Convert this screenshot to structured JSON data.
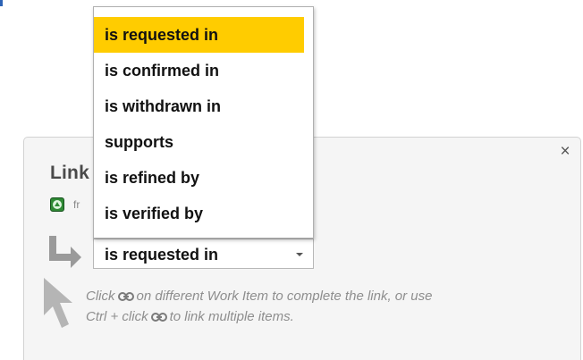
{
  "panel": {
    "title": "Link",
    "item_from": "fr",
    "close_glyph": "×",
    "close_icon": "close-icon"
  },
  "relation_select": {
    "value": "is requested in",
    "options": [
      {
        "label": "is requested in",
        "selected": true
      },
      {
        "label": "is confirmed in",
        "selected": false
      },
      {
        "label": "is withdrawn in",
        "selected": false
      },
      {
        "label": "supports",
        "selected": false
      },
      {
        "label": "is refined by",
        "selected": false
      },
      {
        "label": "is verified by",
        "selected": false
      }
    ],
    "highlight_color": "#ffcc00"
  },
  "hint": {
    "part1": "Click",
    "part2": "on different Work Item to complete the link, or use",
    "part3": "Ctrl + click",
    "part4": "to link multiple items."
  },
  "icons": {
    "item_type": "requirement-up-icon",
    "arrow": "link-arrow-icon",
    "cursor": "cursor-pointer-icon",
    "chain": "chain-link-icon"
  },
  "colors": {
    "panel_bg": "#f5f5f5",
    "item_icon_green": "#2f8a35",
    "hint_text": "#8e8e8e"
  }
}
